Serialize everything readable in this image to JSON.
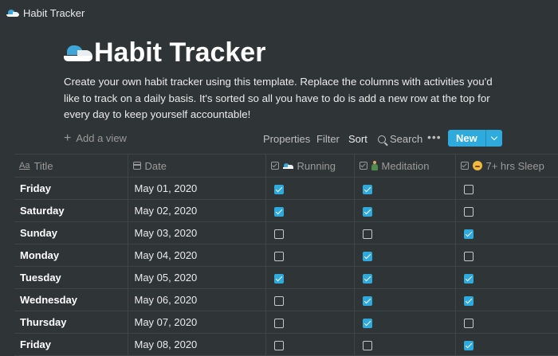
{
  "window": {
    "title": "Habit Tracker"
  },
  "page": {
    "title": "Habit Tracker",
    "description": "Create your own habit tracker using this template. Replace the columns with activities you'd like to track on a daily basis. It's sorted so all you have to do is add a new row at the top for every day to keep yourself accountable!"
  },
  "toolbar": {
    "add_view": "Add a view",
    "properties": "Properties",
    "filter": "Filter",
    "sort": "Sort",
    "search": "Search",
    "more": "•••",
    "new": "New"
  },
  "table": {
    "columns": [
      "Title",
      "Date",
      "Running",
      "Meditation",
      "7+ hrs Sleep"
    ],
    "rows": [
      {
        "title": "Friday",
        "date": "May 01, 2020",
        "running": true,
        "meditation": true,
        "sleep": false
      },
      {
        "title": "Saturday",
        "date": "May 02, 2020",
        "running": true,
        "meditation": true,
        "sleep": false
      },
      {
        "title": "Sunday",
        "date": "May 03, 2020",
        "running": false,
        "meditation": false,
        "sleep": true
      },
      {
        "title": "Monday",
        "date": "May 04, 2020",
        "running": false,
        "meditation": true,
        "sleep": false
      },
      {
        "title": "Tuesday",
        "date": "May 05, 2020",
        "running": true,
        "meditation": true,
        "sleep": true
      },
      {
        "title": "Wednesday",
        "date": "May 06, 2020",
        "running": false,
        "meditation": true,
        "sleep": true
      },
      {
        "title": "Thursday",
        "date": "May 07, 2020",
        "running": false,
        "meditation": true,
        "sleep": false
      },
      {
        "title": "Friday",
        "date": "May 08, 2020",
        "running": false,
        "meditation": false,
        "sleep": true
      }
    ]
  },
  "icons": {
    "page": "running-shoe-icon",
    "title": "text-icon",
    "date": "calendar-icon",
    "checkbox": "checkbox-icon",
    "running": "running-shoe-icon",
    "meditation": "meditation-icon",
    "sleep": "sleepy-face-icon"
  },
  "colors": {
    "background": "#2f3437",
    "accent": "#2eaadc",
    "border": "#3f4447"
  }
}
